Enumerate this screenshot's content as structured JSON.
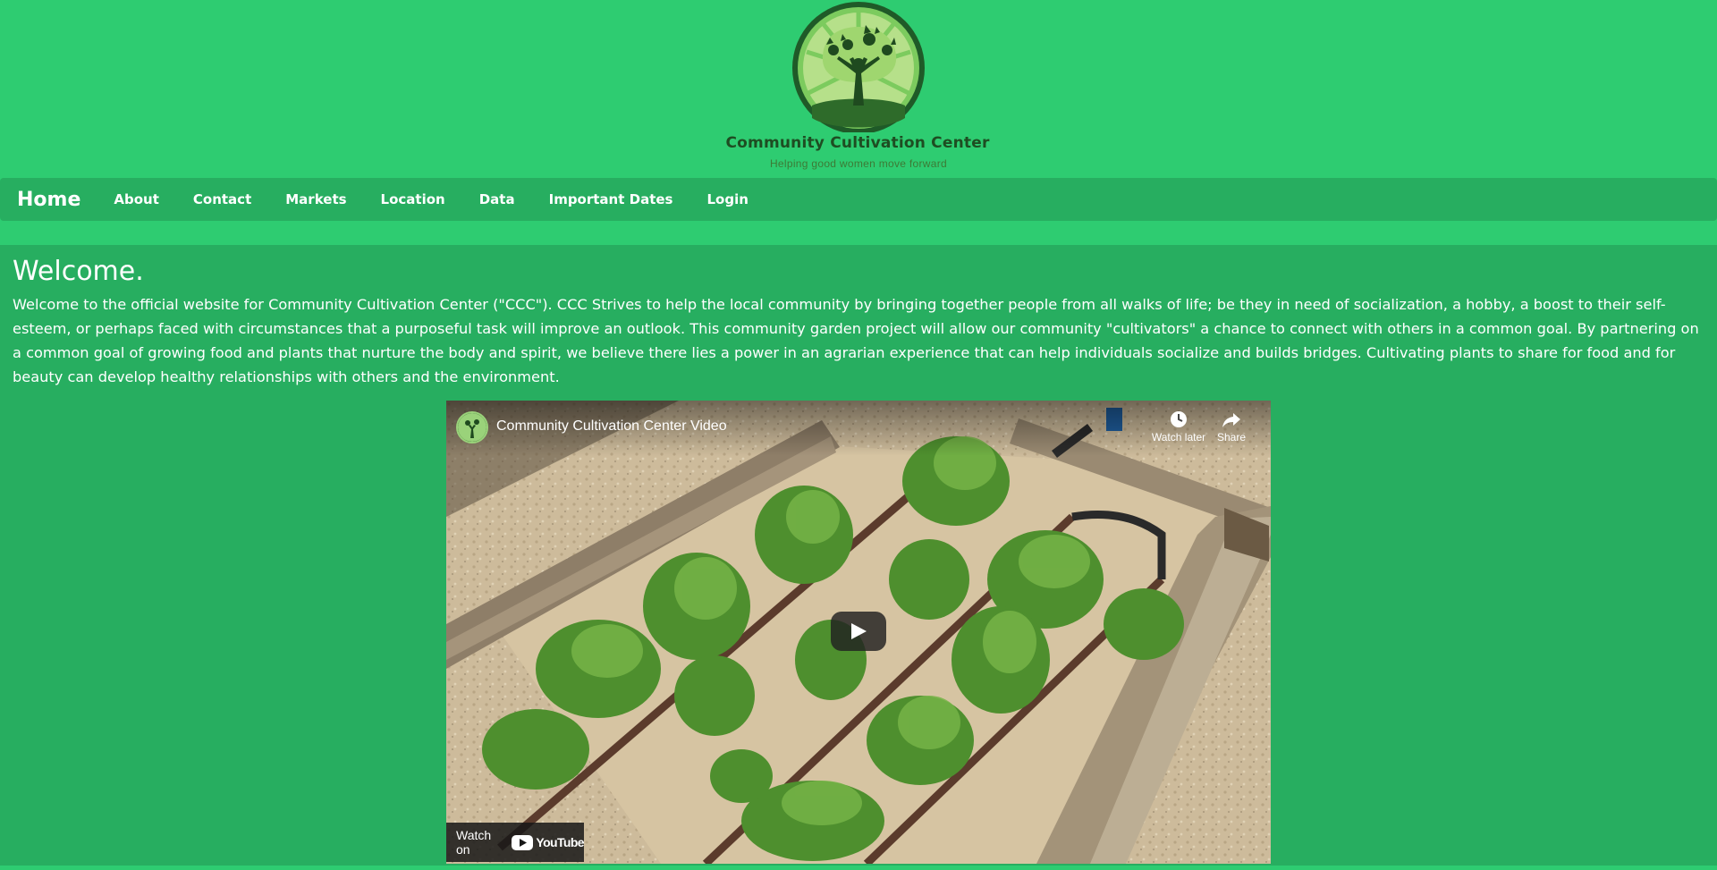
{
  "site": {
    "logo_name": "Community Cultivation Center",
    "logo_tagline": "Helping good women move forward"
  },
  "nav": {
    "brand": "Home",
    "items": [
      {
        "label": "About"
      },
      {
        "label": "Contact"
      },
      {
        "label": "Markets"
      },
      {
        "label": "Location"
      },
      {
        "label": "Data"
      },
      {
        "label": "Important Dates"
      },
      {
        "label": "Login"
      }
    ]
  },
  "main": {
    "title": "Welcome.",
    "body": "Welcome to the official website for Community Cultivation Center (\"CCC\"). CCC Strives to help the local community by bringing together people from all walks of life; be they in need of socialization, a hobby, a boost to their self-esteem, or perhaps faced with circumstances that a purposeful task will improve an outlook. This community garden project will allow our community \"cultivators\" a chance to connect with others in a common goal. By partnering on a common goal of growing food and plants that nurture the body and spirit, we believe there lies a power in an agrarian experience that can help individuals socialize and builds bridges. Cultivating plants to share for food and for beauty can develop healthy relationships with others and the environment."
  },
  "video": {
    "title": "Community Cultivation Center Video",
    "watch_later": "Watch later",
    "share": "Share",
    "watch_on": "Watch on",
    "platform": "YouTube"
  },
  "colors": {
    "page_bg": "#2ecc71",
    "nav_bg": "#27ae60",
    "main_bg": "#27ae60",
    "text": "#ffffff"
  },
  "icons": [
    "logo-tree-icon",
    "clock-icon",
    "share-arrow-icon",
    "play-icon",
    "youtube-logo-icon"
  ]
}
